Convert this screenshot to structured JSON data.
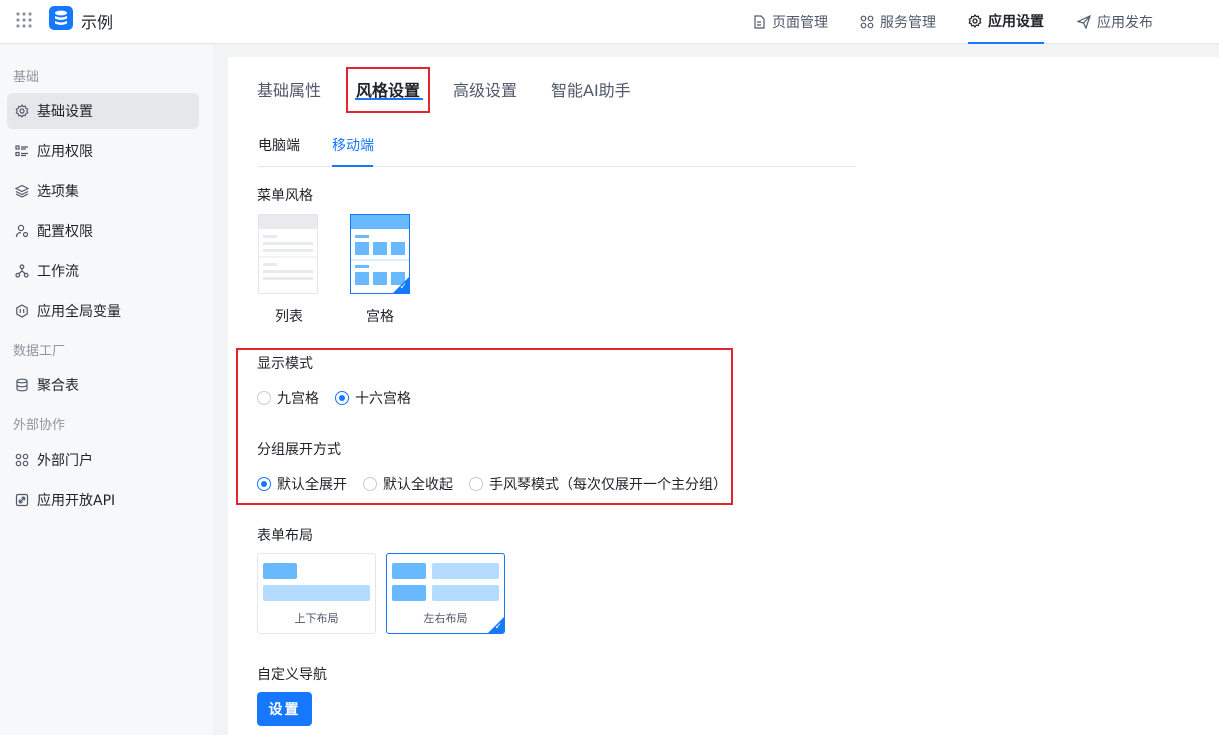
{
  "app": {
    "name": "示例"
  },
  "topnav": [
    {
      "label": "页面管理",
      "icon": "file-icon"
    },
    {
      "label": "服务管理",
      "icon": "services-icon"
    },
    {
      "label": "应用设置",
      "icon": "gear-icon",
      "active": true
    },
    {
      "label": "应用发布",
      "icon": "send-icon"
    }
  ],
  "sidebar": {
    "group_basic": "基础",
    "group_data": "数据工厂",
    "group_external": "外部协作",
    "items": [
      {
        "label": "基础设置",
        "icon": "gear-icon",
        "active": true
      },
      {
        "label": "应用权限",
        "icon": "list-icon"
      },
      {
        "label": "选项集",
        "icon": "layers-icon"
      },
      {
        "label": "配置权限",
        "icon": "user-key-icon"
      },
      {
        "label": "工作流",
        "icon": "workflow-icon"
      },
      {
        "label": "应用全局变量",
        "icon": "hexagon-icon"
      },
      {
        "label": "聚合表",
        "icon": "database-icon"
      },
      {
        "label": "外部门户",
        "icon": "grid-dots-icon"
      },
      {
        "label": "应用开放API",
        "icon": "api-icon"
      }
    ]
  },
  "tabs": [
    "基础属性",
    "风格设置",
    "高级设置",
    "智能AI助手"
  ],
  "subtabs": [
    "电脑端",
    "移动端"
  ],
  "menu_style": {
    "label": "菜单风格",
    "options": [
      "列表",
      "宫格"
    ],
    "selected": "宫格"
  },
  "display_mode": {
    "label": "显示模式",
    "options": [
      "九宫格",
      "十六宫格"
    ],
    "selected": "十六宫格"
  },
  "group_expand": {
    "label": "分组展开方式",
    "options": [
      "默认全展开",
      "默认全收起",
      "手风琴模式（每次仅展开一个主分组）"
    ],
    "selected": "默认全展开"
  },
  "form_layout": {
    "label": "表单布局",
    "options": [
      "上下布局",
      "左右布局"
    ],
    "selected": "左右布局"
  },
  "custom_nav": {
    "label": "自定义导航",
    "button": "设置"
  },
  "colors": {
    "accent": "#1677ff",
    "highlight": "#e0262e",
    "light_block": "#b3dcff",
    "mid_block": "#69b9ff"
  }
}
